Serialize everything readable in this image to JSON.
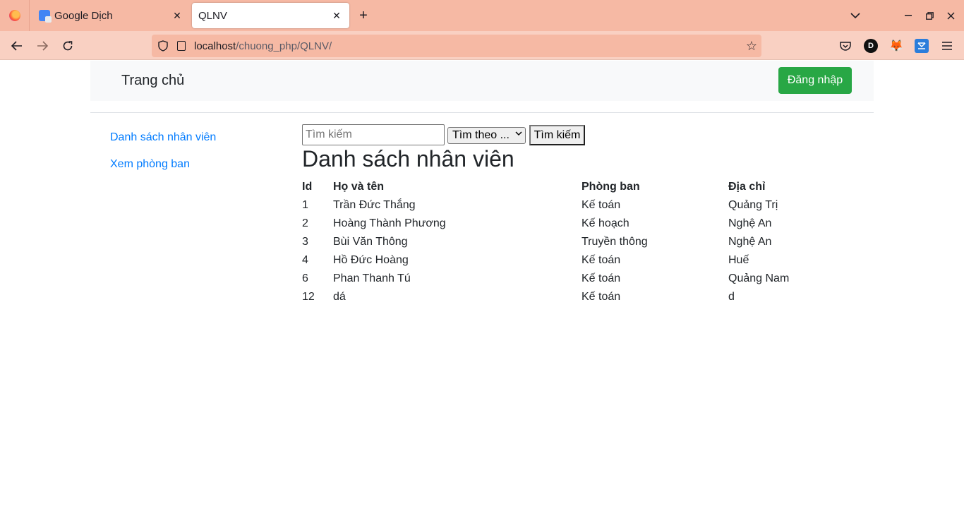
{
  "browser": {
    "tabs": [
      {
        "title": "Google Dịch",
        "active": false
      },
      {
        "title": "QLNV",
        "active": true
      }
    ],
    "url_host": "localhost",
    "url_path": "/chuong_php/QLNV/",
    "extensions": [
      "pocket-icon",
      "d-extension-icon",
      "metamask-fox-icon",
      "blue-extension-icon",
      "menu-icon"
    ]
  },
  "site": {
    "brand": "Trang chủ",
    "login_label": "Đăng nhập",
    "colors": {
      "login": "#28a745",
      "link": "#007bff"
    }
  },
  "sidebar": {
    "items": [
      {
        "label": "Danh sách nhân viên"
      },
      {
        "label": "Xem phòng ban"
      }
    ]
  },
  "search": {
    "placeholder": "Tìm kiếm",
    "select_value": "Tìm theo ...",
    "button_label": "Tìm kiếm"
  },
  "main": {
    "heading": "Danh sách nhân viên",
    "columns": [
      "Id",
      "Họ và tên",
      "Phòng ban",
      "Địa chỉ"
    ],
    "rows": [
      [
        "1",
        "Trần Đức Thắng",
        "Kế toán",
        "Quảng Trị"
      ],
      [
        "2",
        "Hoàng Thành Phương",
        "Kế hoạch",
        "Nghệ An"
      ],
      [
        "3",
        "Bùi Văn Thông",
        "Truyền thông",
        "Nghệ An"
      ],
      [
        "4",
        "Hồ Đức Hoàng",
        "Kế toán",
        "Huế"
      ],
      [
        "6",
        "Phan Thanh Tú",
        "Kế toán",
        "Quảng Nam"
      ],
      [
        "12",
        "dá",
        "Kế toán",
        "d"
      ]
    ]
  }
}
